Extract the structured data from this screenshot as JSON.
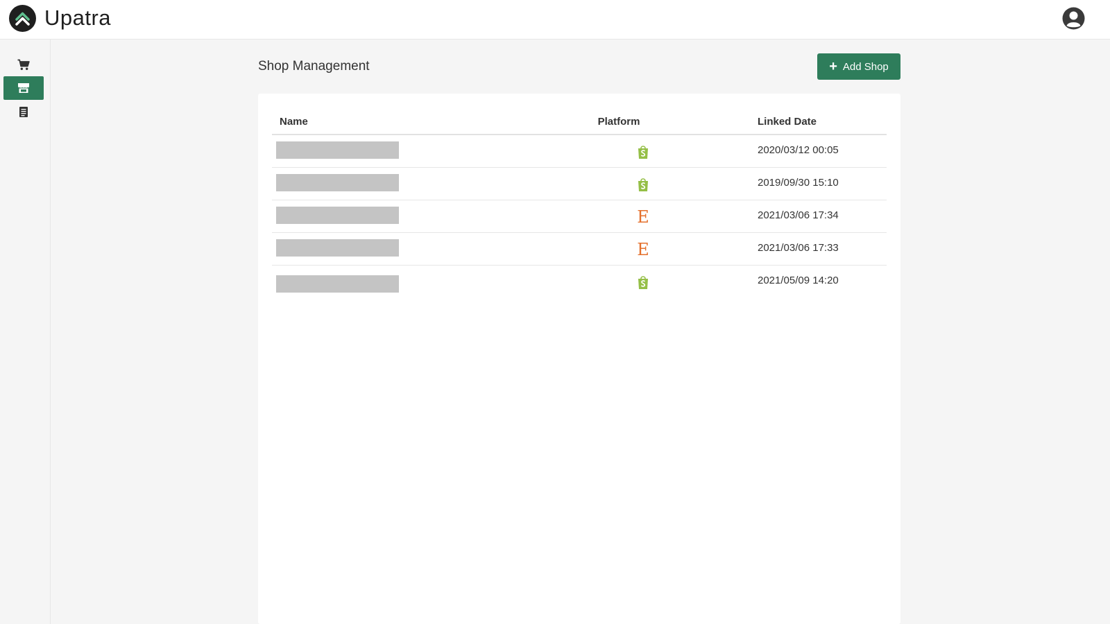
{
  "header": {
    "app_title": "Upatra",
    "logo_icon": "upatra-chevron-logo",
    "user_icon": "user-circle-icon"
  },
  "sidebar": {
    "items": [
      {
        "icon": "cart-icon",
        "active": false
      },
      {
        "icon": "store-icon",
        "active": true
      },
      {
        "icon": "receipt-icon",
        "active": false
      }
    ]
  },
  "page": {
    "title": "Shop Management",
    "add_button_label": "Add Shop"
  },
  "table": {
    "columns": [
      "Name",
      "Platform",
      "Linked Date"
    ],
    "rows": [
      {
        "name": "",
        "platform": "shopify",
        "linked_date": "2020/03/12 00:05"
      },
      {
        "name": "",
        "platform": "shopify",
        "linked_date": "2019/09/30 15:10"
      },
      {
        "name": "",
        "platform": "etsy",
        "linked_date": "2021/03/06 17:34"
      },
      {
        "name": "",
        "platform": "etsy",
        "linked_date": "2021/03/06 17:33"
      },
      {
        "name": "",
        "platform": "shopify",
        "linked_date": "2021/05/09 14:20"
      }
    ]
  },
  "colors": {
    "accent": "#2e7d5b",
    "shopify": "#95bf47",
    "etsy": "#e4702d",
    "redaction": "#c4c4c4"
  }
}
